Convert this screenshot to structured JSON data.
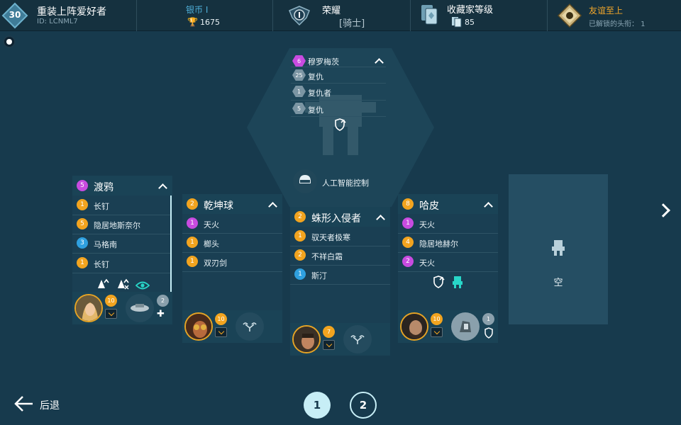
{
  "player": {
    "level": "30",
    "name": "重装上阵爱好者",
    "id": "ID: LCNML7"
  },
  "league": {
    "label": "银币 I",
    "trophies": "1675"
  },
  "honor": {
    "label": "荣耀",
    "rank": "[骑士]"
  },
  "collector": {
    "label": "收藏家等级",
    "value": "85"
  },
  "friendship": {
    "label": "友谊至上",
    "subtitle": "已解锁的头衔：  1"
  },
  "top_robot": {
    "weapons": [
      {
        "level": "6",
        "name": "穆罗梅茨",
        "tier": "purple"
      },
      {
        "level": "25",
        "name": "复仇",
        "tier": "gray"
      },
      {
        "level": "1",
        "name": "复仇者",
        "tier": "gray"
      },
      {
        "level": "5",
        "name": "复仇",
        "tier": "gray"
      }
    ],
    "pilot": "人工智能控制"
  },
  "robots": [
    {
      "level": "5",
      "name": "渡鸦",
      "level_color": "purple",
      "weapons": [
        {
          "level": "1",
          "name": "长钉",
          "color": "orange"
        },
        {
          "level": "5",
          "name": "隐居地斯奈尔",
          "color": "orange"
        },
        {
          "level": "3",
          "name": "马格南",
          "color": "blue"
        },
        {
          "level": "1",
          "name": "长钉",
          "color": "orange"
        }
      ],
      "pilot_level": "10",
      "drone_level": "2"
    },
    {
      "level": "2",
      "name": "乾坤球",
      "level_color": "orange",
      "weapons": [
        {
          "level": "1",
          "name": "天火",
          "color": "purple"
        },
        {
          "level": "1",
          "name": "榔头",
          "color": "orange"
        },
        {
          "level": "1",
          "name": "双刃剑",
          "color": "orange"
        }
      ],
      "pilot_level": "10",
      "drone_level": ""
    },
    {
      "level": "2",
      "name": "蛛形入侵者",
      "level_color": "orange",
      "weapons": [
        {
          "level": "1",
          "name": "驭天者极寒",
          "color": "orange"
        },
        {
          "level": "2",
          "name": "不祥白霜",
          "color": "orange"
        },
        {
          "level": "1",
          "name": "斯汀",
          "color": "blue"
        }
      ],
      "pilot_level": "7",
      "drone_level": ""
    },
    {
      "level": "8",
      "name": "哈皮",
      "level_color": "orange",
      "weapons": [
        {
          "level": "1",
          "name": "天火",
          "color": "purple"
        },
        {
          "level": "4",
          "name": "隐居地赫尔",
          "color": "orange"
        },
        {
          "level": "2",
          "name": "天火",
          "color": "purple"
        }
      ],
      "pilot_level": "10",
      "drone_level": "1"
    }
  ],
  "empty_slot": {
    "label": "空"
  },
  "nav": {
    "back": "后退",
    "pages": [
      "1",
      "2"
    ],
    "active_page": "1"
  }
}
